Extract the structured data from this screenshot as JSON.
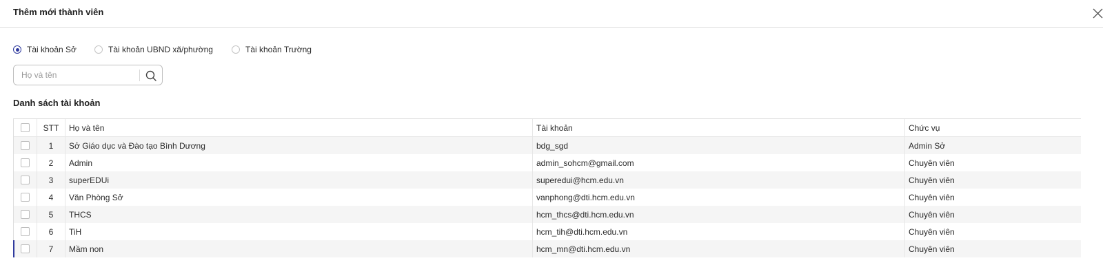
{
  "dialog": {
    "title": "Thêm mới thành viên",
    "close_icon": "close-icon"
  },
  "account_types": [
    {
      "label": "Tài khoản Sở",
      "checked": true
    },
    {
      "label": "Tài khoản UBND xã/phường",
      "checked": false
    },
    {
      "label": "Tài khoản Trường",
      "checked": false
    }
  ],
  "search": {
    "placeholder": "Họ và tên",
    "value": "",
    "icon": "search-icon"
  },
  "list": {
    "title": "Danh sách tài khoản",
    "columns": {
      "stt": "STT",
      "name": "Họ và tên",
      "account": "Tài khoản",
      "role": "Chức vụ"
    },
    "rows": [
      {
        "stt": "1",
        "name": "Sở Giáo dục và Đào tạo Bình Dương",
        "account": "bdg_sgd",
        "role": "Admin Sở"
      },
      {
        "stt": "2",
        "name": "Admin",
        "account": "admin_sohcm@gmail.com",
        "role": "Chuyên viên"
      },
      {
        "stt": "3",
        "name": "superEDUi",
        "account": "superedui@hcm.edu.vn",
        "role": "Chuyên viên"
      },
      {
        "stt": "4",
        "name": "Văn Phòng Sở",
        "account": "vanphong@dti.hcm.edu.vn",
        "role": "Chuyên viên"
      },
      {
        "stt": "5",
        "name": "THCS",
        "account": "hcm_thcs@dti.hcm.edu.vn",
        "role": "Chuyên viên"
      },
      {
        "stt": "6",
        "name": "TiH",
        "account": "hcm_tih@dti.hcm.edu.vn",
        "role": "Chuyên viên"
      },
      {
        "stt": "7",
        "name": "Mầm non",
        "account": "hcm_mn@dti.hcm.edu.vn",
        "role": "Chuyên viên"
      }
    ]
  },
  "colors": {
    "accent": "#2f3a9e",
    "row_stripe": "#f5f5f5",
    "border": "#dedede"
  }
}
